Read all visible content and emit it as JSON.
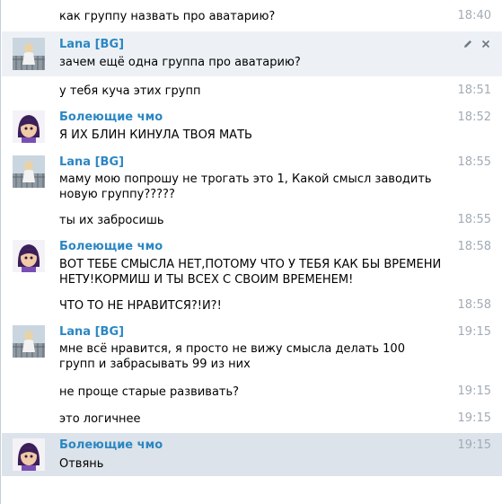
{
  "messages": [
    {
      "text": "как группу назвать про аватарию?",
      "time": "18:40"
    },
    {
      "author": "Lana [BG]",
      "avatar": "lana-avatar",
      "text": "зачем ещё одна группа про аватарию?",
      "tools": [
        "pencil-icon",
        "close-icon"
      ]
    },
    {
      "text": "у тебя куча этих групп",
      "time": "18:51"
    },
    {
      "author": "Болеющие чмо",
      "avatar": "bolejuschie-avatar",
      "text": "Я ИХ БЛИН КИНУЛА ТВОЯ МАТЬ",
      "time": "18:52"
    },
    {
      "author": "Lana [BG]",
      "avatar": "lana-avatar",
      "text": "маму мою попрошу не трогать это 1, Какой смысл заводить новую группу?????",
      "time": "18:55"
    },
    {
      "text": "ты их забросишь",
      "time": "18:55"
    },
    {
      "author": "Болеющие чмо",
      "avatar": "bolejuschie-avatar",
      "text": "ВОТ ТЕБЕ СМЫСЛА НЕТ,ПОТОМУ ЧТО У ТЕБЯ КАК БЫ ВРЕМЕНИ НЕТУ!КОРМИШ И ТЫ ВСЕХ С СВОИМ ВРЕМЕНЕМ!",
      "time": "18:58"
    },
    {
      "text": "ЧТО ТО НЕ НРАВИТСЯ?!И?!",
      "time": "18:58"
    },
    {
      "author": "Lana [BG]",
      "avatar": "lana-avatar",
      "text": "мне всё нравится, я просто не вижу смысла делать 100 групп и забрасывать 99 из них",
      "time": "19:15"
    },
    {
      "text": "не проще старые развивать?",
      "time": "19:15"
    },
    {
      "text": "это логичнее",
      "time": "19:15"
    },
    {
      "author": "Болеющие чмо",
      "avatar": "bolejuschie-avatar",
      "text": "Отвянь",
      "time": "19:15"
    }
  ],
  "colors": {
    "author": "#2b87c3",
    "time": "#a2abb5",
    "hover_row": "#edf1f5",
    "selected_row": "#dde3ea",
    "border": "#c5ced9"
  }
}
